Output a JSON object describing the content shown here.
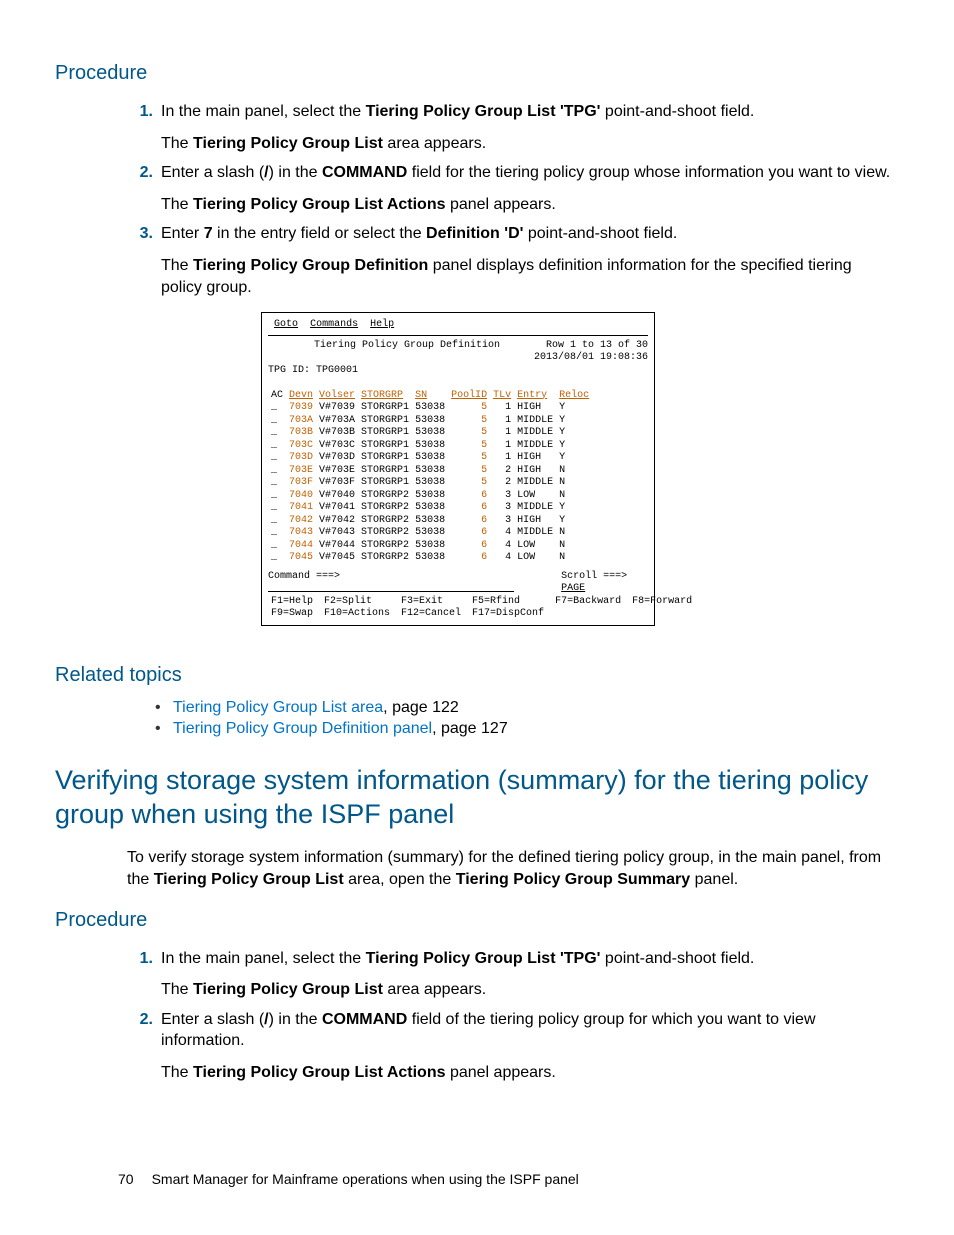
{
  "headings": {
    "procedure": "Procedure",
    "related": "Related topics",
    "section2": "Verifying storage system information (summary) for the tiering policy group when using the ISPF panel"
  },
  "proc1": {
    "s1a": "In the main panel, select the ",
    "s1b": "Tiering Policy Group List 'TPG'",
    "s1c": " point-and-shoot field.",
    "s1f1": "The ",
    "s1f2": "Tiering Policy Group List",
    "s1f3": " area appears.",
    "s2a": "Enter a slash (",
    "s2b": "/",
    "s2c": ") in the ",
    "s2d": "COMMAND",
    "s2e": " field for the tiering policy group whose information you want to view.",
    "s2f1": "The ",
    "s2f2": "Tiering Policy Group List Actions",
    "s2f3": " panel appears.",
    "s3a": "Enter ",
    "s3b": "7",
    "s3c": " in the entry field or select the ",
    "s3d": "Definition 'D'",
    "s3e": " point-and-shoot field.",
    "s3f1": "The ",
    "s3f2": "Tiering Policy Group Definition",
    "s3f3": " panel displays definition information for the specified tiering policy group."
  },
  "related": {
    "r1a": "Tiering Policy Group List area",
    "r1b": ", page 122",
    "r2a": "Tiering Policy Group Definition panel",
    "r2b": ", page 127"
  },
  "intro2a": "To verify storage system information (summary) for the defined tiering policy group, in the main panel, from the ",
  "intro2b": "Tiering Policy Group List",
  "intro2c": " area, open the ",
  "intro2d": "Tiering Policy Group Summary",
  "intro2e": " panel.",
  "proc2": {
    "s1a": "In the main panel, select the ",
    "s1b": "Tiering Policy Group List 'TPG'",
    "s1c": " point-and-shoot field.",
    "s1f1": "The ",
    "s1f2": "Tiering Policy Group List",
    "s1f3": " area appears.",
    "s2a": "Enter a slash (",
    "s2b": "/",
    "s2c": ") in the ",
    "s2d": "COMMAND",
    "s2e": " field of the tiering policy group for which you want to view information.",
    "s2f1": "The ",
    "s2f2": "Tiering Policy Group List Actions",
    "s2f3": " panel appears."
  },
  "terminal": {
    "menu": {
      "g": "G",
      "goto": "oto",
      "c": "C",
      "cmds": "ommands",
      "h": "H",
      "help": "elp"
    },
    "title": "Tiering Policy Group Definition",
    "rowinfo": "Row 1 to 13 of 30",
    "timestamp": "2013/08/01 19:08:36",
    "tpgid_lbl": "TPG ID:",
    "tpgid_val": "TPG0001",
    "hdr": [
      "AC",
      "Devn",
      "Volser",
      "STORGRP",
      "SN",
      "PoolID",
      "TLv",
      "Entry",
      "Reloc"
    ],
    "rows": [
      [
        "_",
        "7039",
        "V#7039",
        "STORGRP1",
        "53038",
        "5",
        "1",
        "HIGH",
        "Y"
      ],
      [
        "_",
        "703A",
        "V#703A",
        "STORGRP1",
        "53038",
        "5",
        "1",
        "MIDDLE",
        "Y"
      ],
      [
        "_",
        "703B",
        "V#703B",
        "STORGRP1",
        "53038",
        "5",
        "1",
        "MIDDLE",
        "Y"
      ],
      [
        "_",
        "703C",
        "V#703C",
        "STORGRP1",
        "53038",
        "5",
        "1",
        "MIDDLE",
        "Y"
      ],
      [
        "_",
        "703D",
        "V#703D",
        "STORGRP1",
        "53038",
        "5",
        "1",
        "HIGH",
        "Y"
      ],
      [
        "_",
        "703E",
        "V#703E",
        "STORGRP1",
        "53038",
        "5",
        "2",
        "HIGH",
        "N"
      ],
      [
        "_",
        "703F",
        "V#703F",
        "STORGRP1",
        "53038",
        "5",
        "2",
        "MIDDLE",
        "N"
      ],
      [
        "_",
        "7040",
        "V#7040",
        "STORGRP2",
        "53038",
        "6",
        "3",
        "LOW",
        "N"
      ],
      [
        "_",
        "7041",
        "V#7041",
        "STORGRP2",
        "53038",
        "6",
        "3",
        "MIDDLE",
        "Y"
      ],
      [
        "_",
        "7042",
        "V#7042",
        "STORGRP2",
        "53038",
        "6",
        "3",
        "HIGH",
        "Y"
      ],
      [
        "_",
        "7043",
        "V#7043",
        "STORGRP2",
        "53038",
        "6",
        "4",
        "MIDDLE",
        "N"
      ],
      [
        "_",
        "7044",
        "V#7044",
        "STORGRP2",
        "53038",
        "6",
        "4",
        "LOW",
        "N"
      ],
      [
        "_",
        "7045",
        "V#7045",
        "STORGRP2",
        "53038",
        "6",
        "4",
        "LOW",
        "N"
      ]
    ],
    "cmd_lbl": "Command ===>",
    "scroll_lbl": "Scroll ===> ",
    "scroll_val": "PAGE",
    "fkeys": [
      [
        "F1=Help",
        "F2=Split",
        "F3=Exit",
        "F5=Rfind",
        "F7=Backward",
        "F8=Forward"
      ],
      [
        "F9=Swap",
        "F10=Actions",
        "F12=Cancel",
        "F17=DispConf",
        "",
        ""
      ]
    ]
  },
  "footer": {
    "page": "70",
    "chapter": "Smart Manager for Mainframe operations when using the ISPF panel"
  },
  "nums": {
    "n1": "1.",
    "n2": "2.",
    "n3": "3."
  }
}
